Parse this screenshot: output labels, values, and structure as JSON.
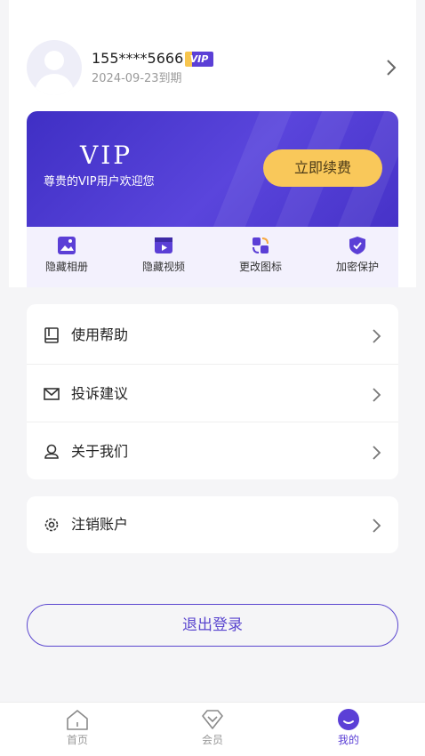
{
  "profile": {
    "phone": "155****5666",
    "vip_badge": "VIP",
    "expire_text": "2024-09-23到期"
  },
  "vip_card": {
    "logo": "VIP",
    "welcome": "尊贵的VIP用户欢迎您",
    "renew_label": "立即续费"
  },
  "features": [
    {
      "label": "隐藏相册",
      "icon": "photo-album-icon"
    },
    {
      "label": "隐藏视频",
      "icon": "video-icon"
    },
    {
      "label": "更改图标",
      "icon": "change-icon-icon"
    },
    {
      "label": "加密保护",
      "icon": "shield-check-icon"
    }
  ],
  "menu": [
    {
      "label": "使用帮助",
      "icon": "book-icon"
    },
    {
      "label": "投诉建议",
      "icon": "mail-icon"
    },
    {
      "label": "关于我们",
      "icon": "user-icon"
    }
  ],
  "menu2": [
    {
      "label": "注销账户",
      "icon": "gear-icon"
    }
  ],
  "logout_label": "退出登录",
  "nav": {
    "items": [
      {
        "label": "首页",
        "icon": "home-icon"
      },
      {
        "label": "会员",
        "icon": "diamond-icon"
      },
      {
        "label": "我的",
        "icon": "profile-icon"
      }
    ],
    "active": "我的"
  },
  "colors": {
    "accent": "#5b3fd6",
    "gold": "#f9c85a",
    "background": "#f5f5f7"
  }
}
